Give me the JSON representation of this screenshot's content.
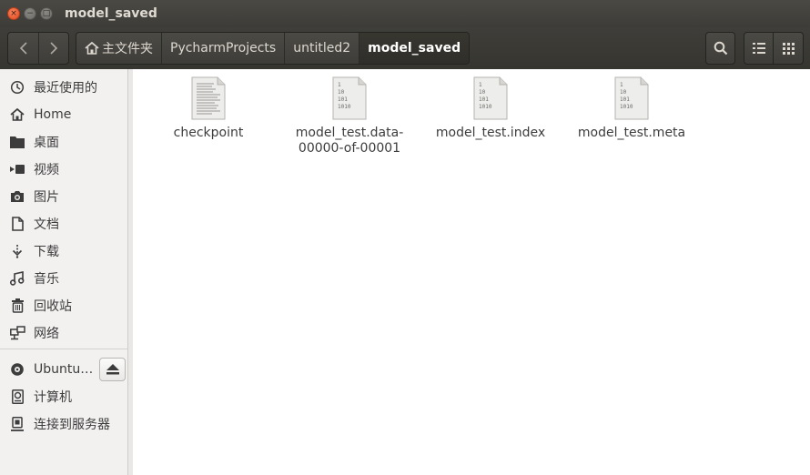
{
  "window": {
    "title": "model_saved",
    "close_glyph": "×",
    "minimize_glyph": "−",
    "maximize_glyph": "□"
  },
  "toolbar": {
    "back_icon": "chevron-left-icon",
    "forward_icon": "chevron-right-icon",
    "breadcrumbs": [
      {
        "label": "主文件夹",
        "icon": "home-icon"
      },
      {
        "label": "PycharmProjects"
      },
      {
        "label": "untitled2"
      },
      {
        "label": "model_saved",
        "active": true
      }
    ],
    "search_icon": "search-icon",
    "list_view_icon": "list-view-icon",
    "grid_view_icon": "grid-view-icon"
  },
  "sidebar": {
    "items": [
      {
        "label": "最近使用的",
        "icon": "recent-clock-icon"
      },
      {
        "label": "Home",
        "icon": "home-icon"
      },
      {
        "label": "桌面",
        "icon": "desktop-folder-icon"
      },
      {
        "label": "视频",
        "icon": "video-icon"
      },
      {
        "label": "图片",
        "icon": "camera-icon"
      },
      {
        "label": "文档",
        "icon": "document-icon"
      },
      {
        "label": "下载",
        "icon": "download-icon"
      },
      {
        "label": "音乐",
        "icon": "music-icon"
      },
      {
        "label": "回收站",
        "icon": "trash-icon"
      },
      {
        "label": "网络",
        "icon": "network-icon"
      },
      {
        "label": "Ubuntu…",
        "icon": "disc-icon"
      },
      {
        "label": "计算机",
        "icon": "computer-icon"
      },
      {
        "label": "连接到服务器",
        "icon": "server-icon"
      }
    ],
    "eject_icon": "eject-icon"
  },
  "files": [
    {
      "name": "checkpoint",
      "type": "text"
    },
    {
      "name": "model_test.data-\n00000-of-00001",
      "type": "binary"
    },
    {
      "name": "model_test.index",
      "type": "binary"
    },
    {
      "name": "model_test.meta",
      "type": "binary"
    }
  ],
  "binary_glyph_lines": [
    "1",
    "10",
    "101",
    "1010"
  ],
  "colors": {
    "titlebar": "#3d3c38",
    "close_button": "#e2491f",
    "sidebar_bg": "#f2f1f0",
    "content_bg": "#ffffff"
  }
}
